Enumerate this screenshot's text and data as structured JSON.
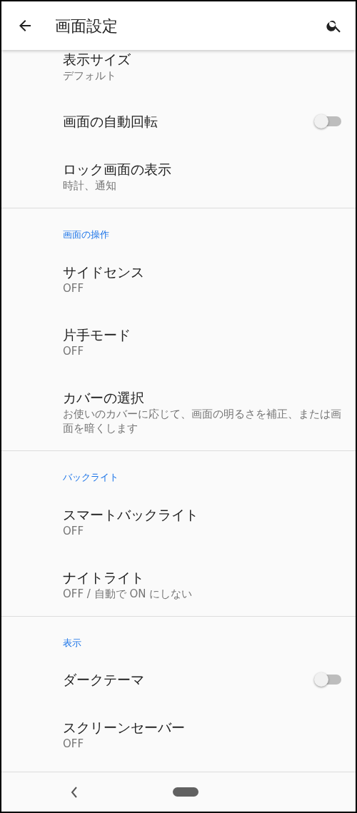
{
  "app_bar": {
    "title": "画面設定"
  },
  "sections": [
    {
      "items": [
        {
          "kind": "text",
          "title": "表示サイズ",
          "summary": "デフォルト"
        },
        {
          "kind": "toggle",
          "title": "画面の自動回転",
          "on": false
        },
        {
          "kind": "text",
          "title": "ロック画面の表示",
          "summary": "時計、通知"
        }
      ]
    },
    {
      "header": "画面の操作",
      "items": [
        {
          "kind": "text",
          "title": "サイドセンス",
          "summary": "OFF"
        },
        {
          "kind": "text",
          "title": "片手モード",
          "summary": "OFF"
        },
        {
          "kind": "text",
          "title": "カバーの選択",
          "summary": "お使いのカバーに応じて、画面の明るさを補正、または画面を暗くします"
        }
      ]
    },
    {
      "header": "バックライト",
      "items": [
        {
          "kind": "text",
          "title": "スマートバックライト",
          "summary": "OFF"
        },
        {
          "kind": "text",
          "title": "ナイトライト",
          "summary": "OFF / 自動で ON にしない"
        }
      ]
    },
    {
      "header": "表示",
      "items": [
        {
          "kind": "toggle",
          "title": "ダークテーマ",
          "on": false
        },
        {
          "kind": "text",
          "title": "スクリーンセーバー",
          "summary": "OFF"
        }
      ]
    }
  ]
}
